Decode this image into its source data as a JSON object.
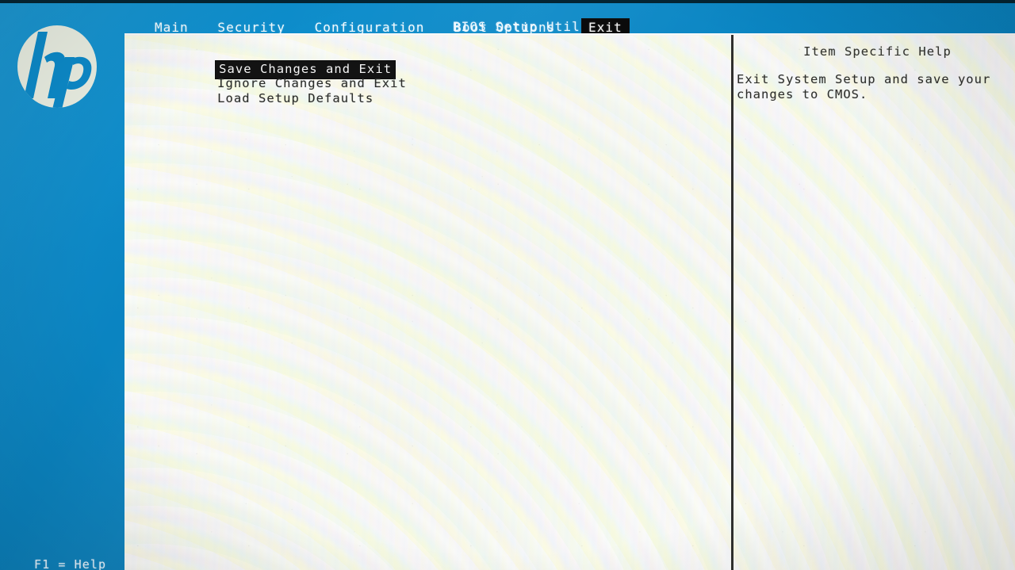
{
  "screen": {
    "title": "BIOS Setup Utility",
    "vendor_logo": "hp-logo"
  },
  "menu_bar": {
    "tabs": [
      {
        "label": "Main",
        "selected": false
      },
      {
        "label": "Security",
        "selected": false
      },
      {
        "label": "Configuration",
        "selected": false
      },
      {
        "label": "Boot Options",
        "selected": false
      },
      {
        "label": "Exit",
        "selected": true
      }
    ]
  },
  "options": {
    "items": [
      {
        "label": "Save Changes and Exit",
        "selected": true
      },
      {
        "label": "Ignore Changes and Exit",
        "selected": false
      },
      {
        "label": "Load Setup Defaults",
        "selected": false
      }
    ]
  },
  "help": {
    "title": "Item Specific Help",
    "body": "Exit System Setup and save your changes to CMOS."
  },
  "footer": {
    "hint": "F1 = Help"
  },
  "colors": {
    "brand_blue": "#0b86c4",
    "brand_blue_dark": "#0a76ad",
    "panel_bg": "#eef0ec",
    "selection_bg": "#131313",
    "selection_fg": "#f4f4f4",
    "text": "#2a2c2a",
    "menu_text": "#f2fbff"
  }
}
